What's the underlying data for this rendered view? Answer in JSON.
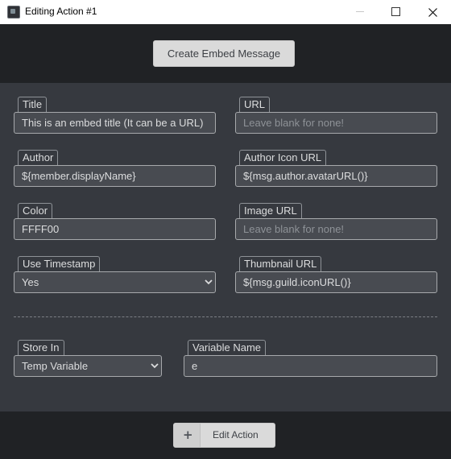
{
  "window": {
    "title": "Editing Action #1",
    "controls": [
      "minimize-icon",
      "maximize-icon",
      "close-icon"
    ]
  },
  "header": {
    "create_embed_label": "Create Embed Message"
  },
  "fields": {
    "title": {
      "label": "Title",
      "value": "This is an embed title (It can be a URL)"
    },
    "url": {
      "label": "URL",
      "placeholder": "Leave blank for none!"
    },
    "author": {
      "label": "Author",
      "value": "${member.displayName}"
    },
    "author_icon_url": {
      "label": "Author Icon URL",
      "value": "${msg.author.avatarURL()}"
    },
    "color": {
      "label": "Color",
      "value": "FFFF00"
    },
    "image_url": {
      "label": "Image URL",
      "placeholder": "Leave blank for none!"
    },
    "use_timestamp": {
      "label": "Use Timestamp",
      "selected": "Yes"
    },
    "thumbnail_url": {
      "label": "Thumbnail URL",
      "value": "${msg.guild.iconURL()}"
    },
    "store_in": {
      "label": "Store In",
      "selected": "Temp Variable"
    },
    "variable_name": {
      "label": "Variable Name",
      "value": "e"
    }
  },
  "footer": {
    "edit_action_label": "Edit Action",
    "plus_symbol": "+"
  },
  "colors": {
    "background": "#36393f",
    "band": "#202225",
    "input_bg": "#484b51",
    "button_bg": "#dadada"
  }
}
